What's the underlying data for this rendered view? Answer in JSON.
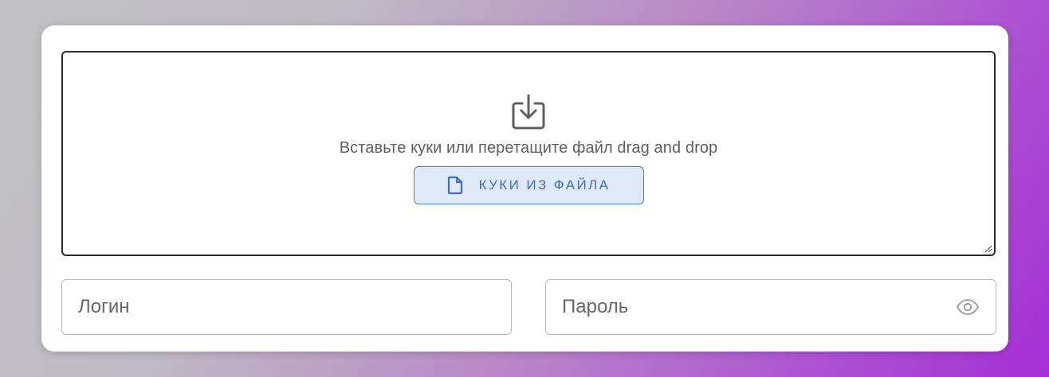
{
  "dropzone": {
    "hint": "Вставьте куки или перетащите файл drag and drop",
    "icon": "download-tray-icon",
    "file_button": {
      "label": "Куки из файла",
      "icon": "file-icon"
    }
  },
  "login": {
    "value": "",
    "placeholder": "Логин"
  },
  "password": {
    "value": "",
    "placeholder": "Пароль",
    "toggle_icon": "eye-icon"
  },
  "colors": {
    "accent": "#3a6fc4",
    "accent_bg": "#dfe9f8",
    "border": "#b9b9b9"
  }
}
